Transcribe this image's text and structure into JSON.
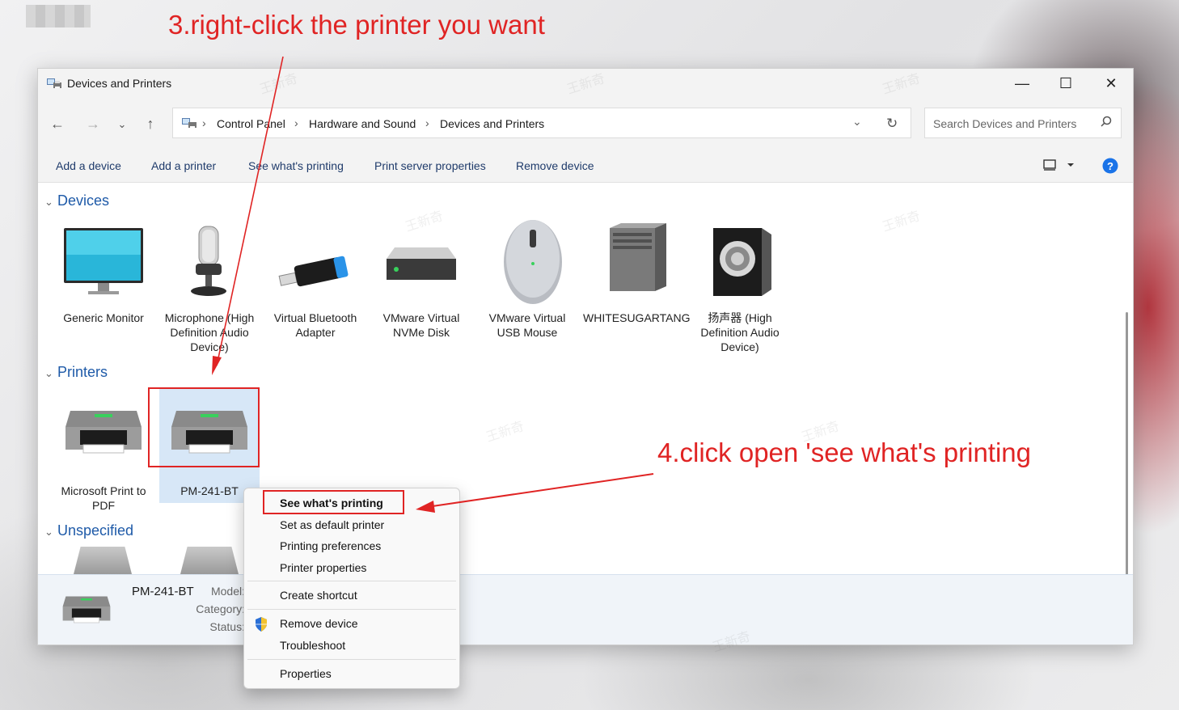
{
  "annotations": {
    "step3": "3.right-click the printer you want",
    "step4": "4.click open 'see what's printing"
  },
  "window": {
    "title": "Devices and Printers",
    "controls": {
      "minimize": "—",
      "maximize": "☐",
      "close": "✕"
    }
  },
  "address": {
    "breadcrumb": [
      "Control Panel",
      "Hardware and Sound",
      "Devices and Printers"
    ],
    "search_placeholder": "Search Devices and Printers"
  },
  "commands": [
    "Add a device",
    "Add a printer",
    "See what's printing",
    "Print server properties",
    "Remove device"
  ],
  "groups": {
    "devices": "Devices",
    "printers": "Printers",
    "unspecified": "Unspecified"
  },
  "devices": [
    {
      "label": "Generic Monitor",
      "icon": "monitor-icon"
    },
    {
      "label": "Microphone (High Definition Audio Device)",
      "icon": "microphone-icon"
    },
    {
      "label": "Virtual Bluetooth Adapter",
      "icon": "usb-dongle-icon"
    },
    {
      "label": "VMware Virtual NVMe Disk",
      "icon": "disk-drive-icon"
    },
    {
      "label": "VMware Virtual USB Mouse",
      "icon": "mouse-icon"
    },
    {
      "label": "WHITESUGARTANG",
      "icon": "computer-tower-icon"
    },
    {
      "label": "扬声器 (High Definition Audio Device)",
      "icon": "speaker-icon"
    }
  ],
  "printers": [
    {
      "label": "Microsoft Print to PDF",
      "icon": "printer-icon"
    },
    {
      "label": "PM-241-BT",
      "icon": "printer-icon",
      "selected": true
    }
  ],
  "details": {
    "name": "PM-241-BT",
    "labels": [
      "Model:",
      "Category:",
      "Status:"
    ]
  },
  "context_menu": {
    "items": [
      {
        "label": "See what's printing",
        "bold": true
      },
      {
        "label": "Set as default printer"
      },
      {
        "label": "Printing preferences"
      },
      {
        "label": "Printer properties"
      },
      {
        "label": "Create shortcut"
      },
      {
        "label": "Remove device",
        "icon": "shield-icon"
      },
      {
        "label": "Troubleshoot"
      },
      {
        "label": "Properties"
      }
    ]
  },
  "colors": {
    "annotation": "#e02424",
    "link": "#1e5aa8",
    "help": "#1a73e8"
  }
}
